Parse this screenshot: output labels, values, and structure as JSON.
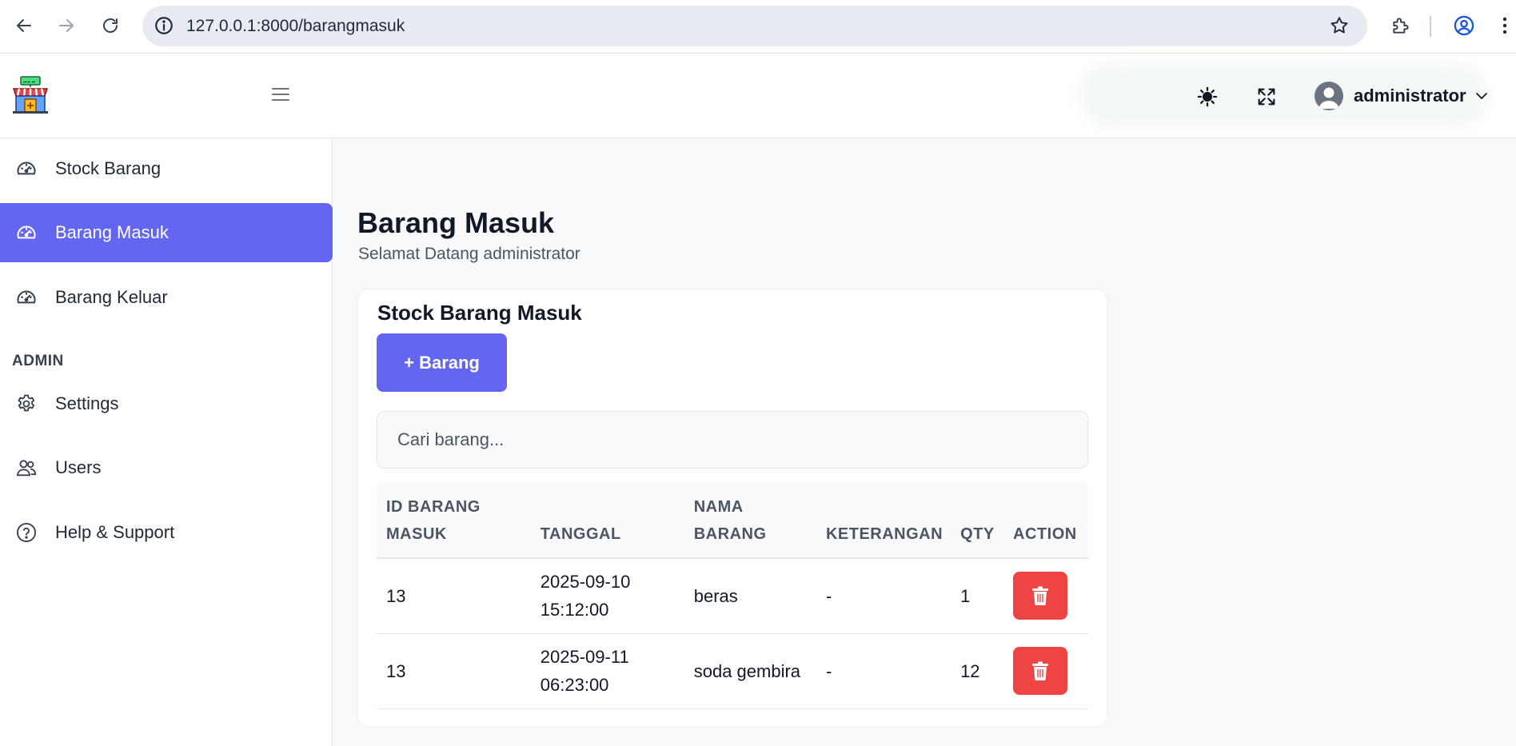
{
  "browser": {
    "url": "127.0.0.1:8000/barangmasuk"
  },
  "header": {
    "logo": "shop-logo",
    "username": "administrator"
  },
  "sidebar": {
    "items": [
      {
        "label": "Stock Barang",
        "icon": "gauge-icon"
      },
      {
        "label": "Barang Masuk",
        "icon": "gauge-icon",
        "active": true
      },
      {
        "label": "Barang Keluar",
        "icon": "gauge-icon"
      }
    ],
    "section_label": "ADMIN",
    "admin_items": [
      {
        "label": "Settings",
        "icon": "gear-icon"
      },
      {
        "label": "Users",
        "icon": "users-icon"
      },
      {
        "label": "Help & Support",
        "icon": "help-icon"
      }
    ]
  },
  "main": {
    "title": "Barang Masuk",
    "subtitle": "Selamat Datang administrator",
    "card": {
      "title": "Stock Barang Masuk",
      "add_button": "+ Barang",
      "search_placeholder": "Cari barang...",
      "columns": {
        "id_line1": "ID BARANG",
        "id_line2": "MASUK",
        "tanggal": "TANGGAL",
        "nama_line1": "NAMA",
        "nama_line2": "BARANG",
        "keterangan": "KETERANGAN",
        "qty": "QTY",
        "action": "ACTION"
      },
      "rows": [
        {
          "id": "13",
          "date": "2025-09-10",
          "time": "15:12:00",
          "nama": "beras",
          "keterangan": "-",
          "qty": "1"
        },
        {
          "id": "13",
          "date": "2025-09-11",
          "time": "06:23:00",
          "nama": "soda gembira",
          "keterangan": "-",
          "qty": "12"
        }
      ]
    }
  },
  "colors": {
    "accent": "#6366f1",
    "danger": "#ef4444"
  }
}
